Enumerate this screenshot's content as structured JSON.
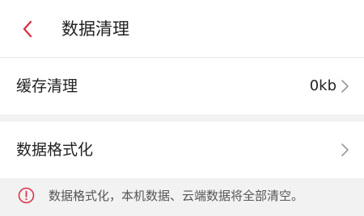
{
  "header": {
    "title": "数据清理",
    "back_icon": "chevron-left-icon",
    "accent_color": "#d8344a"
  },
  "settings": {
    "cache_clear": {
      "label": "缓存清理",
      "value": "0kb",
      "icon": "chevron-right-icon"
    },
    "data_format": {
      "label": "数据格式化",
      "icon": "chevron-right-icon"
    }
  },
  "notice": {
    "icon": "alert-circle-icon",
    "icon_color": "#d8344a",
    "text": "数据格式化，本机数据、云端数据将全部清空。"
  }
}
